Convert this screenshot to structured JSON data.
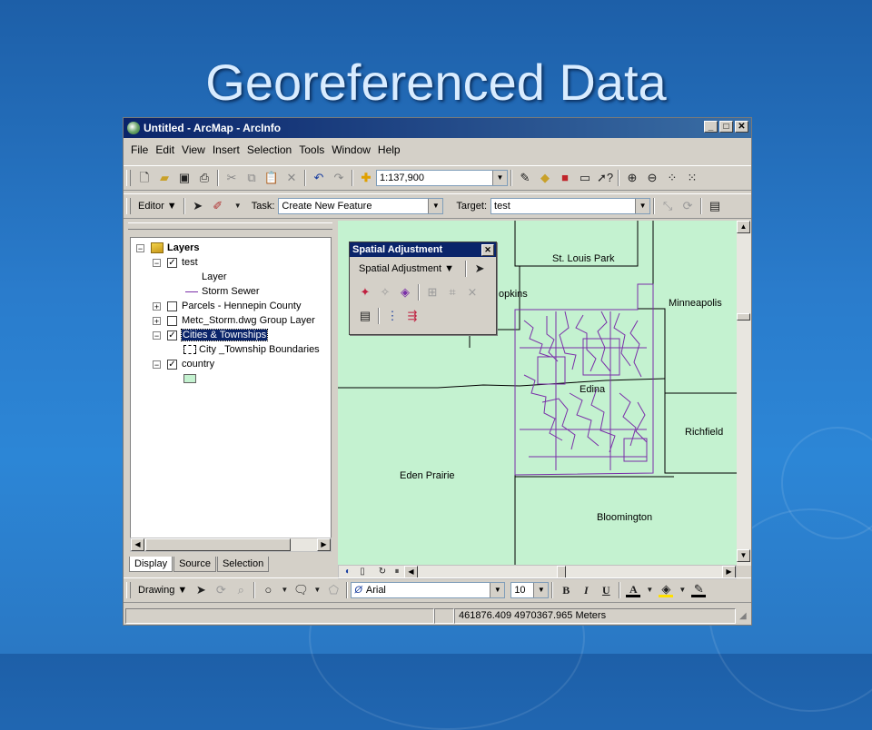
{
  "slide_title": "Georeferenced Data",
  "window": {
    "title": "Untitled - ArcMap - ArcInfo",
    "controls": [
      "_",
      "□",
      "✕"
    ]
  },
  "menu": [
    "File",
    "Edit",
    "View",
    "Insert",
    "Selection",
    "Tools",
    "Window",
    "Help"
  ],
  "standard_toolbar": {
    "scale": "1:137,900"
  },
  "editor_toolbar": {
    "editor_label": "Editor",
    "task_label": "Task:",
    "task_value": "Create New Feature",
    "target_label": "Target:",
    "target_value": "test"
  },
  "toc": {
    "root": "Layers",
    "items": [
      {
        "label": "test"
      },
      {
        "label": "Layer"
      },
      {
        "label": "Storm Sewer"
      },
      {
        "label": "Parcels - Hennepin County"
      },
      {
        "label": "Metc_Storm.dwg Group Layer"
      },
      {
        "label": "Cities & Townships"
      },
      {
        "label": "City _Township Boundaries"
      },
      {
        "label": "country"
      }
    ],
    "tabs": [
      "Display",
      "Source",
      "Selection"
    ]
  },
  "spatial_adjustment": {
    "title": "Spatial Adjustment",
    "menu_label": "Spatial Adjustment"
  },
  "map_labels": [
    "St. Louis Park",
    "Minneapolis",
    "opkins",
    "Edina",
    "Richfield",
    "Eden Prairie",
    "Bloomington"
  ],
  "drawing_toolbar": {
    "drawing_label": "Drawing",
    "font_name": "Arial",
    "font_size": "10",
    "bold": "B",
    "italic": "I",
    "underline": "U",
    "font_color": "A"
  },
  "status": {
    "coords": "461876.409  4970367.965 Meters"
  },
  "colors": {
    "map_fill": "#c4f2d0",
    "sewer": "#7a2fa8",
    "title_bar": "#0a246a"
  }
}
